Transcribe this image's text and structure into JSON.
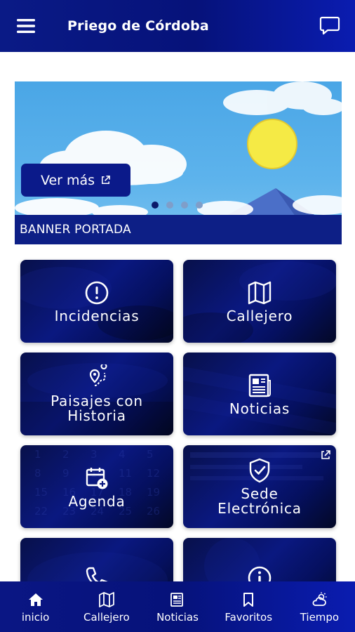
{
  "header": {
    "title": "Priego de Córdoba"
  },
  "banner": {
    "button_label": "Ver más",
    "caption": "BANNER PORTADA",
    "slide_count": 4,
    "active_slide": 1
  },
  "tiles": [
    {
      "label": "Incidencias",
      "icon": "alert-circle-icon"
    },
    {
      "label": "Callejero",
      "icon": "map-icon"
    },
    {
      "label": "Paisajes con\nHistoria",
      "icon": "route-pin-icon"
    },
    {
      "label": "Noticias",
      "icon": "newspaper-icon"
    },
    {
      "label": "Agenda",
      "icon": "calendar-add-icon"
    },
    {
      "label": "Sede\nElectrónica",
      "icon": "shield-check-icon",
      "external": true
    },
    {
      "label": "",
      "icon": "phone-icon"
    },
    {
      "label": "",
      "icon": "info-icon"
    }
  ],
  "bottom_nav": [
    {
      "label": "inicio",
      "icon": "home-icon"
    },
    {
      "label": "Callejero",
      "icon": "map-icon"
    },
    {
      "label": "Noticias",
      "icon": "newspaper-icon"
    },
    {
      "label": "Favoritos",
      "icon": "bookmark-icon"
    },
    {
      "label": "Tiempo",
      "icon": "weather-icon"
    }
  ],
  "colors": {
    "primary": "#06127a",
    "accent": "#0a1cb0",
    "banner_caption": "#0d1f86"
  }
}
